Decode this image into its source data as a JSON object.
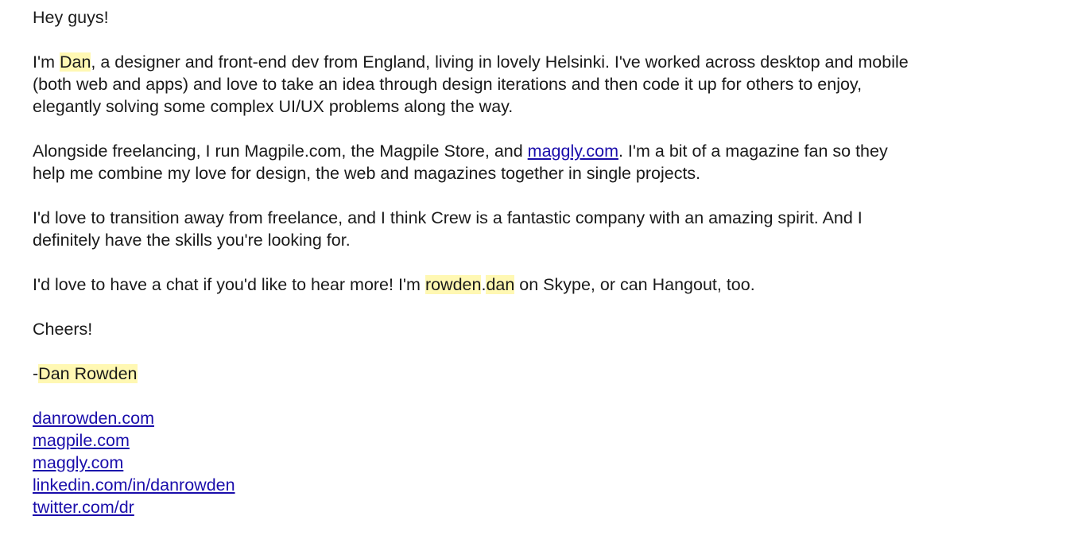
{
  "email": {
    "greeting": "Hey guys!",
    "para1": {
      "t1": "I'm ",
      "name": "Dan",
      "t2": ", a designer and front-end dev from England, living in lovely Helsinki. I've worked across desktop and mobile",
      "t3": "(both web and apps) and love to take an idea through design iterations and then code it up for others to enjoy,",
      "t4": "elegantly solving some complex UI/UX problems along the way."
    },
    "para2": {
      "t1": "Alongside freelancing, I run Magpile.com, the Magpile Store, and ",
      "link": "maggly.com",
      "t2": ". I'm a bit of a magazine fan so they",
      "t3": "help me combine my love for design, the web and magazines together in single projects."
    },
    "para3": {
      "t1": "I'd love to transition away from freelance, and I think Crew is a fantastic company with an amazing spirit. And I",
      "t2": "definitely have the skills you're looking for."
    },
    "para4": {
      "t1": "I'd love to have a chat if you'd like to hear more! I'm ",
      "skype_a": "rowden",
      "dot": ".",
      "skype_b": "dan",
      "t2": " on Skype, or can Hangout, too."
    },
    "signoff": "Cheers!",
    "signature": {
      "dash": "-",
      "first": "Dan",
      "space": " ",
      "last": "Rowden"
    },
    "links": [
      "danrowden.com",
      "magpile.com",
      "maggly.com",
      "linkedin.com/in/danrowden",
      "twitter.com/dr"
    ],
    "highlight_color": "#fff8b3",
    "link_color": "#1a0dab"
  }
}
